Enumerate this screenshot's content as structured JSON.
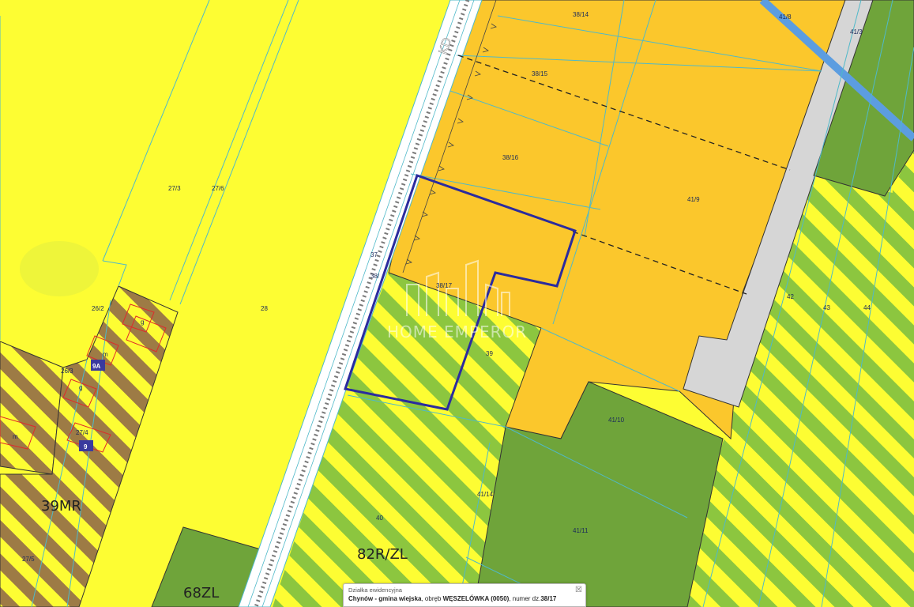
{
  "map": {
    "colors": {
      "agri": "#fdfd33",
      "orange": "#fbc72c",
      "green_dark": "#6fa43a",
      "green_light": "#8cc63f",
      "brown": "#9d7b45",
      "road_gray": "#d6d6d6",
      "parcel_line": "#4fb9c9",
      "zone_line": "#333333",
      "selection": "#2b2b9e",
      "water": "#5c9de0"
    },
    "parcels": [
      "38/14",
      "41/8",
      "41/3",
      "38/15",
      "38/16",
      "41/9",
      "27/3",
      "27/6",
      "37",
      "38/",
      "38/17",
      "28",
      "26/2",
      "26/3",
      "27/4",
      "42",
      "43",
      "44",
      "39",
      "41/10",
      "41/14",
      "40",
      "41/11",
      "27/5"
    ],
    "building_labels": [
      "m",
      "g",
      "9A",
      "g",
      "m",
      "9"
    ],
    "zones": [
      "39MR",
      "82R/ZL",
      "68ZL"
    ],
    "road_label": "KD"
  },
  "watermark": {
    "text": "HOME EMPEROR"
  },
  "popup": {
    "title": "Działka ewidencyjna",
    "location": "Chynów - gmina wiejska",
    "precinct_prefix": ", obręb ",
    "precinct": "WĘSZELÓWKA (0050)",
    "number_prefix": ", numer dz.",
    "number": "38/17",
    "close": "☒"
  }
}
